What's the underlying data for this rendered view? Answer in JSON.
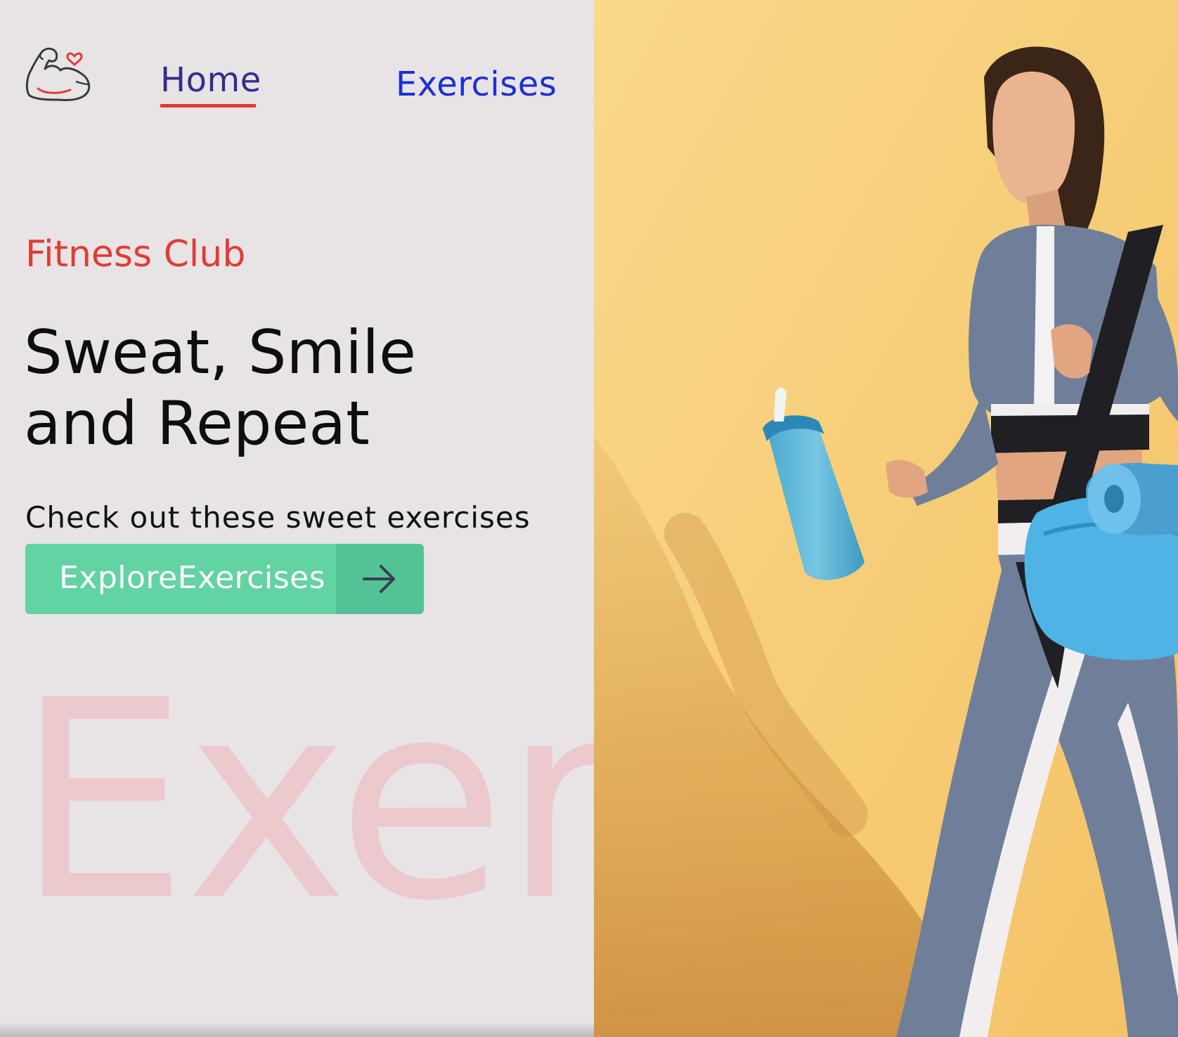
{
  "nav": {
    "home_label": "Home",
    "exercises_label": "Exercises"
  },
  "hero": {
    "subtitle": "Fitness Club",
    "headline_line1": "Sweat, Smile",
    "headline_line2": "and Repeat",
    "tagline": "Check out these sweet exercises",
    "cta_label": "ExploreExercises",
    "watermark": "Exercise"
  },
  "icons": {
    "logo": "flexed-bicep-heart-icon",
    "cta_arrow": "arrow-right-icon"
  },
  "colors": {
    "background": "#e8e4e6",
    "accent_red": "#e23b33",
    "home_link": "#3a2a8c",
    "exercises_link": "#1c2fd6",
    "cta_green": "#62d3a3",
    "cta_green_dark": "#53c395",
    "watermark": "#ecc9cc",
    "hero_yellow": "#f9d583"
  }
}
